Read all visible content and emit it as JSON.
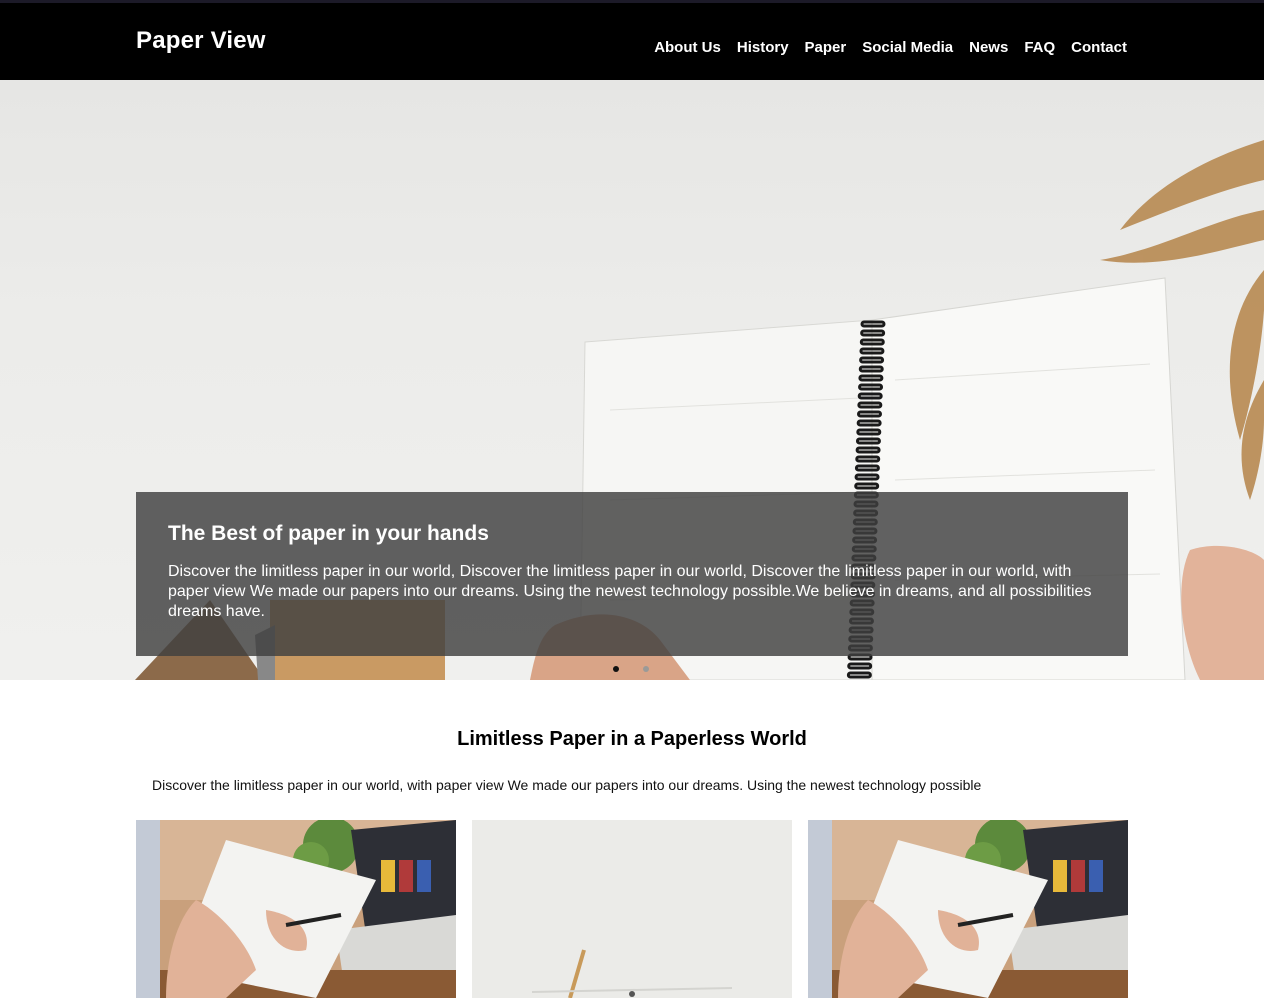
{
  "header": {
    "brand": "Paper View",
    "nav": [
      {
        "label": "About Us"
      },
      {
        "label": "History"
      },
      {
        "label": "Paper"
      },
      {
        "label": "Social Media"
      },
      {
        "label": "News"
      },
      {
        "label": "FAQ"
      },
      {
        "label": "Contact"
      }
    ]
  },
  "hero": {
    "title": "The Best of paper in your hands",
    "text": "Discover the limitless paper in our world, Discover the limitless paper in our world, Discover the limitless paper in our world, with paper view We made our papers into our dreams. Using the newest technology possible.We believe in dreams, and all possibilities dreams have.",
    "slides_total": 2,
    "active_slide": 1
  },
  "intro": {
    "title": "Limitless Paper in a Paperless World",
    "text": "Discover the limitless paper in our world, with paper view We made our papers into our dreams. Using the newest technology possible"
  },
  "colors": {
    "navbar_bg": "#000000",
    "caption_bg": "#404040"
  }
}
